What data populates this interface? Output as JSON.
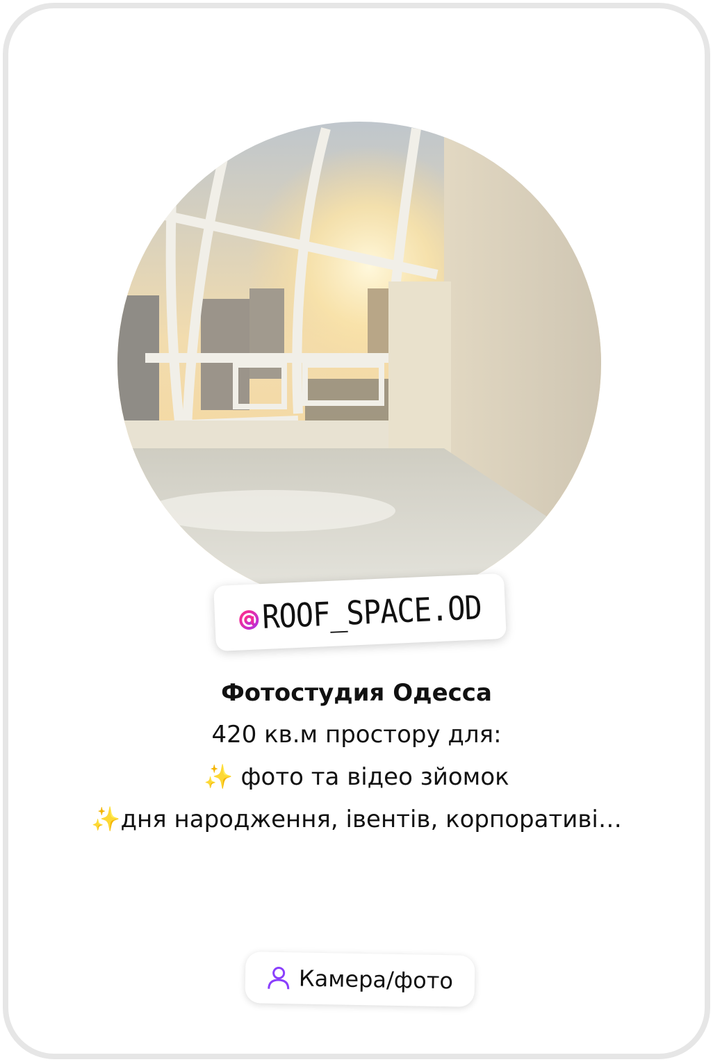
{
  "profile": {
    "avatar_image": "sunlit-rooftop-studio-photo",
    "handle_prefix_icon": "at-sign-icon",
    "handle": "ROOF_SPACE.OD",
    "handle_at": "@",
    "name": "Фотостудия Одесса",
    "bio_lines": [
      "420 кв.м простору для:",
      "✨ фото та відео зйомок",
      "✨дня народження, івентів, корпоративі…"
    ]
  },
  "category_pill": {
    "icon": "person-icon",
    "label": "Камера/фото"
  },
  "colors": {
    "frame_border": "#e6e6e6",
    "handle_gradient_start": "#ff2d8a",
    "handle_gradient_end": "#b42ee0",
    "pill_icon": "#8a3ffc",
    "text": "#111111"
  }
}
